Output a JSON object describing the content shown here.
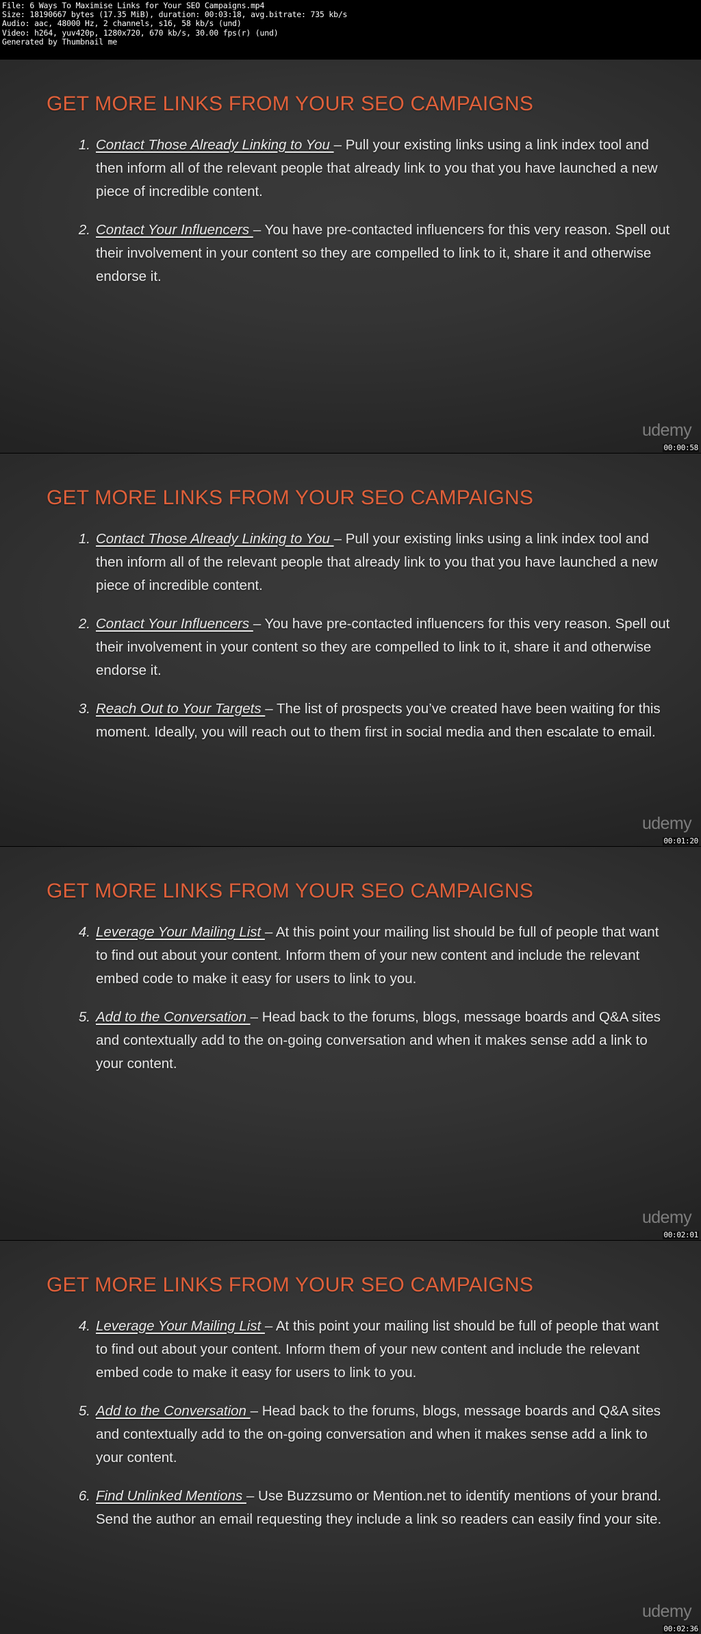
{
  "header": {
    "lines": [
      "File: 6 Ways To Maximise Links for Your SEO Campaigns.mp4",
      "Size: 18190667 bytes (17.35 MiB), duration: 00:03:18, avg.bitrate: 735 kb/s",
      "Audio: aac, 48000 Hz, 2 channels, s16, 58 kb/s (und)",
      "Video: h264, yuv420p, 1280x720, 670 kb/s, 30.00 fps(r) (und)",
      "Generated by Thumbnail me"
    ]
  },
  "colors": {
    "title": "#e0603a",
    "body": "#e9e9e9",
    "watermark": "#8d8d8d",
    "slide_bg": "#343434"
  },
  "watermark_label": "udemy",
  "slides": [
    {
      "title": "GET MORE LINKS FROM YOUR SEO CAMPAIGNS",
      "timestamp": "00:00:58",
      "items": [
        {
          "number": "1.",
          "lead": "Contact Those Already Linking to You ",
          "body": "– Pull your existing links using a link index tool and then inform all of the relevant people that already link to you that you have launched a new piece of incredible content."
        },
        {
          "number": "2.",
          "lead": "Contact Your Influencers ",
          "body": "– You have pre-contacted influencers for this very reason. Spell out their involvement in your content so they are compelled to link to it, share it and otherwise endorse it."
        }
      ]
    },
    {
      "title": "GET MORE LINKS FROM YOUR SEO CAMPAIGNS",
      "timestamp": "00:01:20",
      "items": [
        {
          "number": "1.",
          "lead": "Contact Those Already Linking to You ",
          "body": "– Pull your existing links using a link index tool and then inform all of the relevant people that already link to you that you have launched a new piece of incredible content."
        },
        {
          "number": "2.",
          "lead": "Contact Your Influencers ",
          "body": "– You have pre-contacted influencers for this very reason. Spell out their involvement in your content so they are compelled to link to it, share it and otherwise endorse it."
        },
        {
          "number": "3.",
          "lead": "Reach Out to Your Targets ",
          "body": "– The list of prospects you’ve created have been waiting for this moment. Ideally, you will reach out to them first in social media and then escalate to email."
        }
      ]
    },
    {
      "title": "GET MORE LINKS FROM YOUR SEO CAMPAIGNS",
      "timestamp": "00:02:01",
      "items": [
        {
          "number": "4.",
          "lead": "Leverage Your Mailing List ",
          "body": "– At this point your mailing list should be full of people that want to find out about your content. Inform them of your new content and include the relevant embed code to make it easy for users to link to you."
        },
        {
          "number": "5.",
          "lead": "Add to the Conversation ",
          "body": "– Head back to the forums, blogs, message boards and Q&A sites and contextually add to the on-going conversation and when it makes sense add a link to your content."
        }
      ]
    },
    {
      "title": "GET MORE LINKS FROM YOUR SEO CAMPAIGNS",
      "timestamp": "00:02:36",
      "items": [
        {
          "number": "4.",
          "lead": "Leverage Your Mailing List ",
          "body": "– At this point your mailing list should be full of people that want to find out about your content. Inform them of your new content and include the relevant embed code to make it easy for users to link to you."
        },
        {
          "number": "5.",
          "lead": "Add to the Conversation ",
          "body": "– Head back to the forums, blogs, message boards and Q&A sites and contextually add to the on-going conversation and when it makes sense add a link to your content."
        },
        {
          "number": "6.",
          "lead": "Find Unlinked Mentions ",
          "body": "– Use Buzzsumo or Mention.net to identify mentions of your brand. Send the author an email requesting they include a link so readers can easily find your site."
        }
      ]
    }
  ]
}
